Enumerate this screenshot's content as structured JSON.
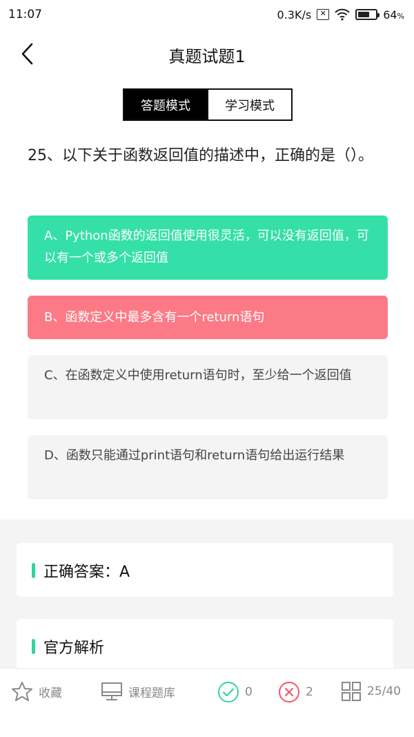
{
  "status_bar": {
    "time": "11:07",
    "network_speed": "0.3K/s",
    "battery_percent": "64",
    "battery_unit": "%",
    "battery_level": 0.64
  },
  "nav": {
    "title": "真题试题1",
    "back_icon": "chevron-left-icon"
  },
  "mode_toggle": {
    "answer_mode": "答题模式",
    "study_mode": "学习模式",
    "selected": "answer_mode"
  },
  "question": {
    "text": "25、以下关于函数返回值的描述中，正确的是（）。"
  },
  "options": [
    {
      "label": "A、Python函数的返回值使用很灵活，可以没有返回值，可以有一个或多个返回值",
      "state": "correct"
    },
    {
      "label": "B、函数定义中最多含有一个return语句",
      "state": "wrong"
    },
    {
      "label": "C、在函数定义中使用return语句时，至少给一个返回值",
      "state": "normal"
    },
    {
      "label": "D、函数只能通过print语句和return语句给出运行结果",
      "state": "normal"
    }
  ],
  "answer_card": {
    "title": "正确答案：A"
  },
  "official_card": {
    "title": "官方解析"
  },
  "bottom_bar": {
    "favorite_label": "收藏",
    "course_label": "课程题库",
    "correct_count": "0",
    "wrong_count": "2",
    "progress": "25/40"
  },
  "colors": {
    "correct": "#34e0a7",
    "wrong": "#fb7a86",
    "accent": "#34d39e"
  }
}
